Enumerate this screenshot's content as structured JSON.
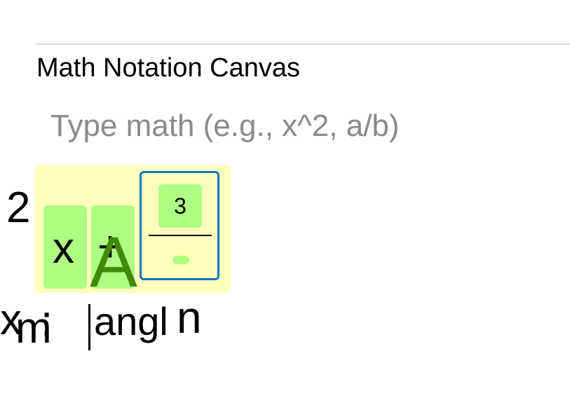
{
  "canvas": {
    "title": "Math Notation Canvas",
    "input_placeholder": "Type math (e.g., x^2, a/b)",
    "input_value": ""
  },
  "expression": {
    "exponent": "2",
    "variable": "x",
    "operator": "+",
    "cursor_glyph": "A",
    "fraction": {
      "numerator": "3",
      "denominator": ""
    }
  },
  "bottom_line": {
    "x": "x",
    "m": "m",
    "colon": ":",
    "word": "angl",
    "n": "n"
  }
}
